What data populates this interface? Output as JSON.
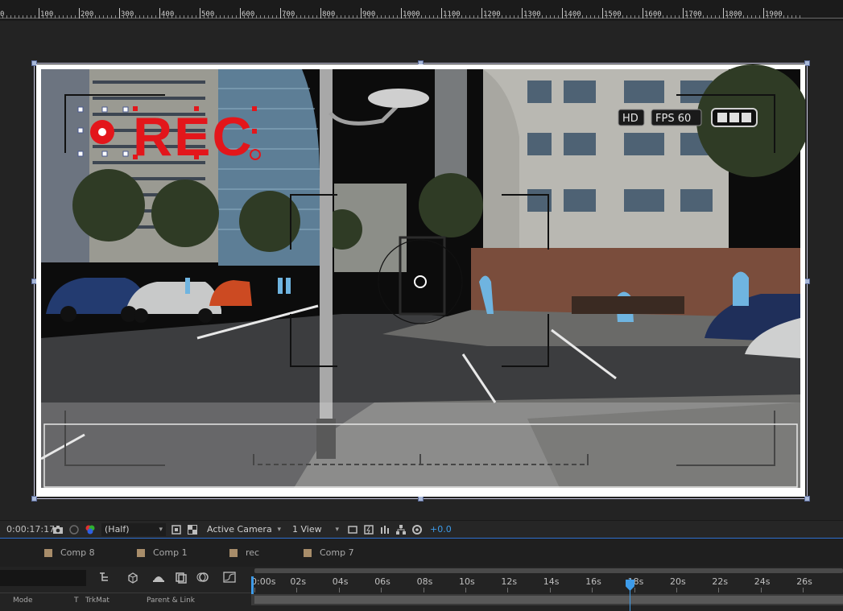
{
  "ruler": {
    "labels": [
      "0",
      "100",
      "200",
      "300",
      "400",
      "500",
      "600",
      "700",
      "800",
      "900",
      "1000",
      "1100",
      "1200",
      "1300",
      "1400",
      "1500",
      "1600",
      "1700",
      "1800",
      "1900"
    ]
  },
  "viewer": {
    "overlay": {
      "rec_label": "REC",
      "hd_badge": "HD",
      "fps_badge": "FPS 60"
    }
  },
  "viewer_toolbar": {
    "timecode": "0:00:17:17",
    "resolution": "(Half)",
    "camera": "Active Camera",
    "views": "1 View",
    "exposure": "+0.0"
  },
  "comp_tabs": [
    {
      "label": "Comp 8"
    },
    {
      "label": "Comp 1"
    },
    {
      "label": "rec"
    },
    {
      "label": "Comp 7"
    }
  ],
  "timeline": {
    "columns": {
      "mode": "Mode",
      "t": "T",
      "trkmat": "TrkMat",
      "parent": "Parent & Link"
    },
    "time_labels": [
      "0:00s",
      "02s",
      "04s",
      "06s",
      "08s",
      "10s",
      "12s",
      "14s",
      "16s",
      "18s",
      "20s",
      "22s",
      "24s",
      "26s"
    ]
  },
  "colors": {
    "accent": "#3d9be9",
    "rec_red": "#e3161b",
    "tab_swatch": "#a88d6a"
  }
}
